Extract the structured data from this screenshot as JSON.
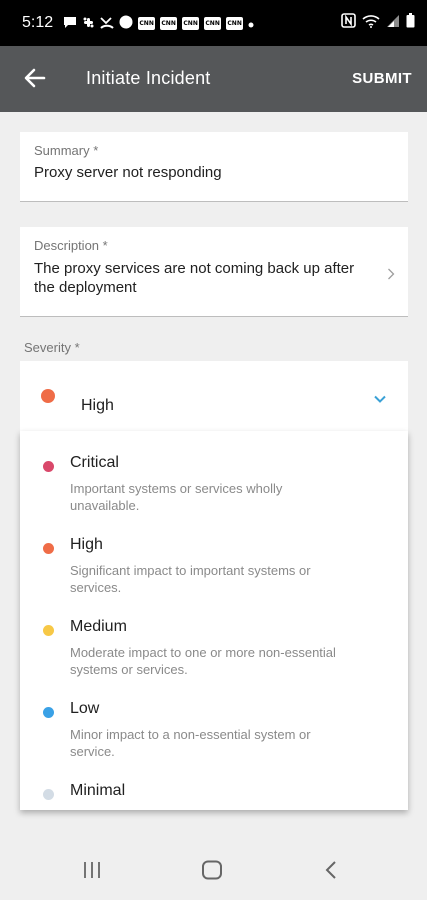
{
  "status_bar": {
    "time": "5:12",
    "left_icons": [
      "message-icon",
      "slack-icon",
      "missed-call-icon",
      "circle-icon",
      "cnn-icon",
      "cnn-icon",
      "cnn-icon",
      "cnn-icon",
      "cnn-icon",
      "dot-icon"
    ],
    "cnn_label": "CNN",
    "right_icons": [
      "nfc-icon",
      "wifi-icon",
      "signal-icon",
      "battery-icon"
    ]
  },
  "app_bar": {
    "title": "Initiate Incident",
    "submit_label": "SUBMIT",
    "background": "#555759"
  },
  "summary": {
    "label": "Summary *",
    "value": "Proxy server not responding"
  },
  "description": {
    "label": "Description *",
    "line1": "The proxy services are not coming back up after",
    "line2": "the deployment"
  },
  "severity": {
    "label": "Severity *",
    "selected": "High",
    "selected_color": "#ef6c47",
    "chevron_color": "#3aa1d6",
    "options": [
      {
        "title": "Critical",
        "line1": "Important systems or services wholly",
        "line2": "unavailable.",
        "color": "#d9486a"
      },
      {
        "title": "High",
        "line1": "Significant impact to important systems or",
        "line2": "services.",
        "color": "#ef6c47"
      },
      {
        "title": "Medium",
        "line1": "Moderate impact to one or more non-essential",
        "line2": "systems or services.",
        "color": "#f7c846"
      },
      {
        "title": "Low",
        "line1": "Minor impact to a non-essential system or",
        "line2": "service.",
        "color": "#3aa1e6"
      },
      {
        "title": "Minimal",
        "line1": "",
        "line2": "",
        "color": "#d3dce5"
      }
    ]
  },
  "nav_bar": {
    "items": [
      "recent-apps-icon",
      "home-icon",
      "back-nav-icon"
    ]
  }
}
